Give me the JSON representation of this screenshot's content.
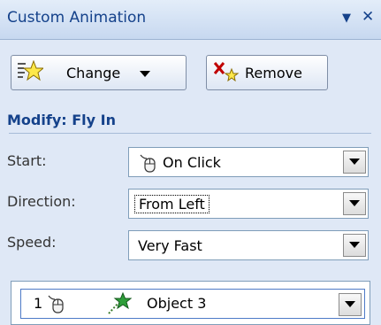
{
  "panel": {
    "title": "Custom Animation",
    "dropdown_icon": "triangle-down-icon",
    "close_icon": "close-icon"
  },
  "toolbar": {
    "change_label": "Change",
    "remove_label": "Remove"
  },
  "modify": {
    "heading": "Modify: Fly In",
    "start_label": "Start:",
    "start_value": "On Click",
    "direction_label": "Direction:",
    "direction_value": "From Left",
    "speed_label": "Speed:",
    "speed_value": "Very Fast"
  },
  "list": {
    "items": [
      {
        "number": "1",
        "name": "Object 3"
      }
    ]
  },
  "colors": {
    "panel_bg": "#dfe8f6",
    "title_text": "#15428b",
    "selection_border": "#4e7ac7"
  }
}
